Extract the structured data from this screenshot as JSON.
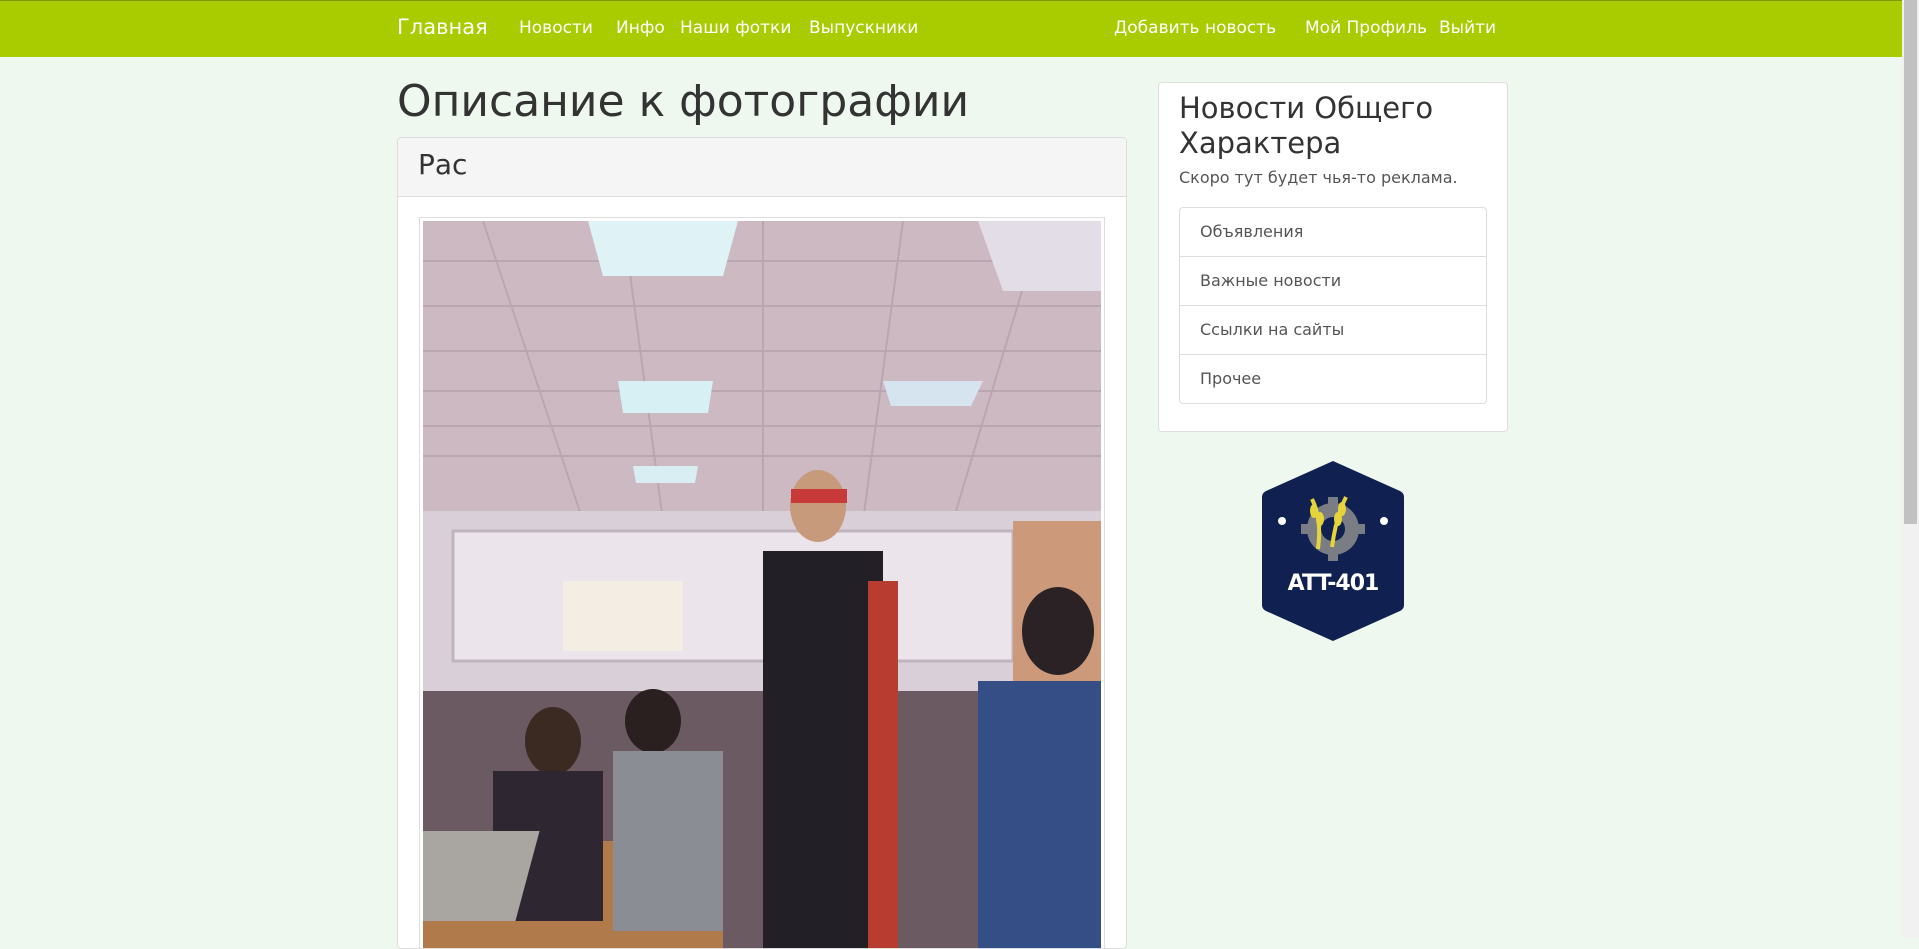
{
  "navbar": {
    "brand": "Главная",
    "left_links": [
      "Новости",
      "Инфо",
      "Наши фотки",
      "Выпускники"
    ],
    "right_links": [
      "Добавить новость",
      "Мой Профиль",
      "Выйти"
    ],
    "bg_color": "#a9cc00"
  },
  "main": {
    "title": "Описание к фотографии",
    "panel_title": "Рас",
    "photo_alt_icon": "classroom-photo"
  },
  "sidebar": {
    "title": "Новости Общего Характера",
    "description": "Скоро тут будет чья-то реклама.",
    "items": [
      "Объявления",
      "Важные новости",
      "Ссылки на сайты",
      "Прочее"
    ]
  },
  "logo": {
    "text": "ATT-401",
    "icon": "wheat-gear-icon",
    "bg_color": "#102050"
  }
}
